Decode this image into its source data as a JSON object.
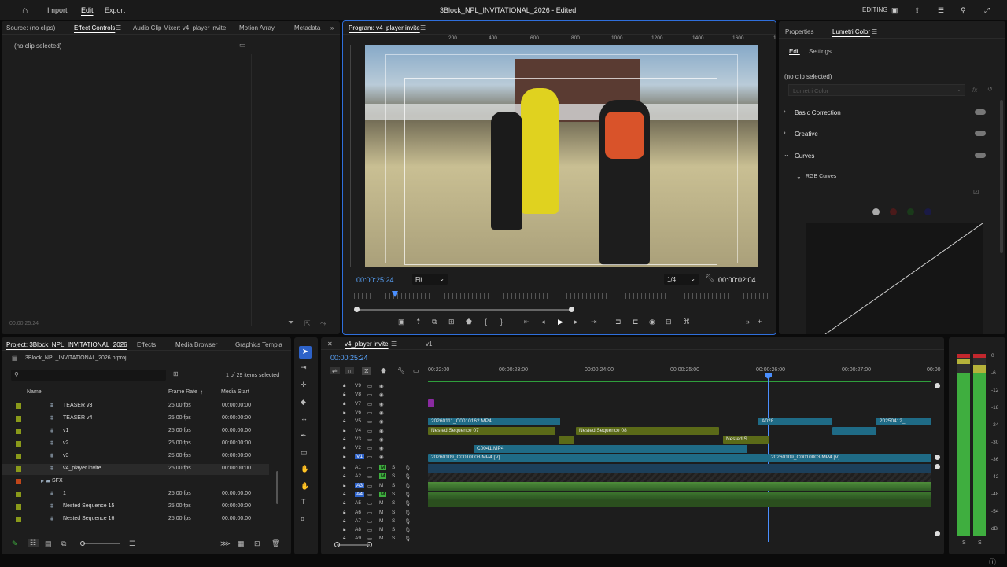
{
  "menu": {
    "home_icon": "home-icon",
    "import": "Import",
    "edit": "Edit",
    "export": "Export",
    "title": "3Block_NPL_INVITATIONAL_2026 - Edited",
    "workspace": "EDITING"
  },
  "source_panel": {
    "tabs": [
      "Source: (no clips)",
      "Effect Controls",
      "Audio Clip Mixer: v4_player invite",
      "Motion Array",
      "Metadata"
    ],
    "no_clip": "(no clip selected)",
    "timecode": "00:00:25:24"
  },
  "program": {
    "tab": "Program: v4_player invite",
    "ruler": [
      "200",
      "400",
      "600",
      "800",
      "1000",
      "1200",
      "1400",
      "1600",
      "1800"
    ],
    "timecode": "00:00:25:24",
    "fit": "Fit",
    "resolution": "1/4",
    "duration": "00:00:02:04"
  },
  "lumetri": {
    "tabs": [
      "Properties",
      "Lumetri Color"
    ],
    "subtabs": [
      "Edit",
      "Settings"
    ],
    "no_clip": "(no clip selected)",
    "dropdown": "Lumetri Color",
    "sections": [
      "Basic Correction",
      "Creative",
      "Curves"
    ],
    "sub": "RGB Curves"
  },
  "project": {
    "tabs": [
      "Project: 3Block_NPL_INVITATIONAL_2026",
      "Effects",
      "Media Browser",
      "Graphics Templa"
    ],
    "file": "3Block_NPL_INVITATIONAL_2026.prproj",
    "selection": "1 of 29 items selected",
    "headers": [
      "Name",
      "Frame Rate",
      "Media Start"
    ],
    "rows": [
      {
        "name": "TEASER v3",
        "fps": "25,00 fps",
        "start": "00:00:00:00",
        "color": "#8a9a1a"
      },
      {
        "name": "TEASER v4",
        "fps": "25,00 fps",
        "start": "00:00:00:00",
        "color": "#8a9a1a"
      },
      {
        "name": "v1",
        "fps": "25,00 fps",
        "start": "00:00:00:00",
        "color": "#8a9a1a"
      },
      {
        "name": "v2",
        "fps": "25,00 fps",
        "start": "00:00:00:00",
        "color": "#8a9a1a"
      },
      {
        "name": "v3",
        "fps": "25,00 fps",
        "start": "00:00:00:00",
        "color": "#8a9a1a"
      },
      {
        "name": "v4_player invite",
        "fps": "25,00 fps",
        "start": "00:00:00:00",
        "color": "#8a9a1a"
      },
      {
        "name": "SFX",
        "fps": "",
        "start": "",
        "color": "#c0461a"
      },
      {
        "name": "1",
        "fps": "25,00 fps",
        "start": "00:00:00:00",
        "color": "#8a9a1a"
      },
      {
        "name": "Nested Sequence 15",
        "fps": "25,00 fps",
        "start": "00:00:00:00",
        "color": "#8a9a1a"
      },
      {
        "name": "Nested Sequence 16",
        "fps": "25,00 fps",
        "start": "00:00:00:00",
        "color": "#8a9a1a"
      }
    ]
  },
  "timeline": {
    "tabs": [
      "v4_player invite",
      "v1"
    ],
    "timecode": "00:00:25:24",
    "ruler": [
      "00:22:00",
      "00:00:23:00",
      "00:00:24:00",
      "00:00:25:00",
      "00:00:26:00",
      "00:00:27:00",
      "00:00"
    ],
    "video_tracks": [
      "V9",
      "V8",
      "V7",
      "V6",
      "V5",
      "V4",
      "V3",
      "V2",
      "V1"
    ],
    "audio_tracks": [
      "A1",
      "A2",
      "A3",
      "A4",
      "A5",
      "A6",
      "A7",
      "A8",
      "A9"
    ],
    "clips": {
      "c1": "20260111_C0010162.MP4",
      "c2": "Nested Sequence 07",
      "c3": "Nested Sequence 08",
      "c4": "A028...",
      "c5": "20250412_...",
      "c6": "Nested S...",
      "c7": "C0041.MP4",
      "c8": "20260109_C0010003.MP4 [V]",
      "c9": "20260109_C0010003.MP4 [V]"
    }
  },
  "meter": {
    "labels": [
      "0",
      "-6",
      "-12",
      "-18",
      "-24",
      "-30",
      "-36",
      "-42",
      "-48",
      "-54",
      "dB"
    ],
    "solo": [
      "S",
      "S"
    ]
  }
}
